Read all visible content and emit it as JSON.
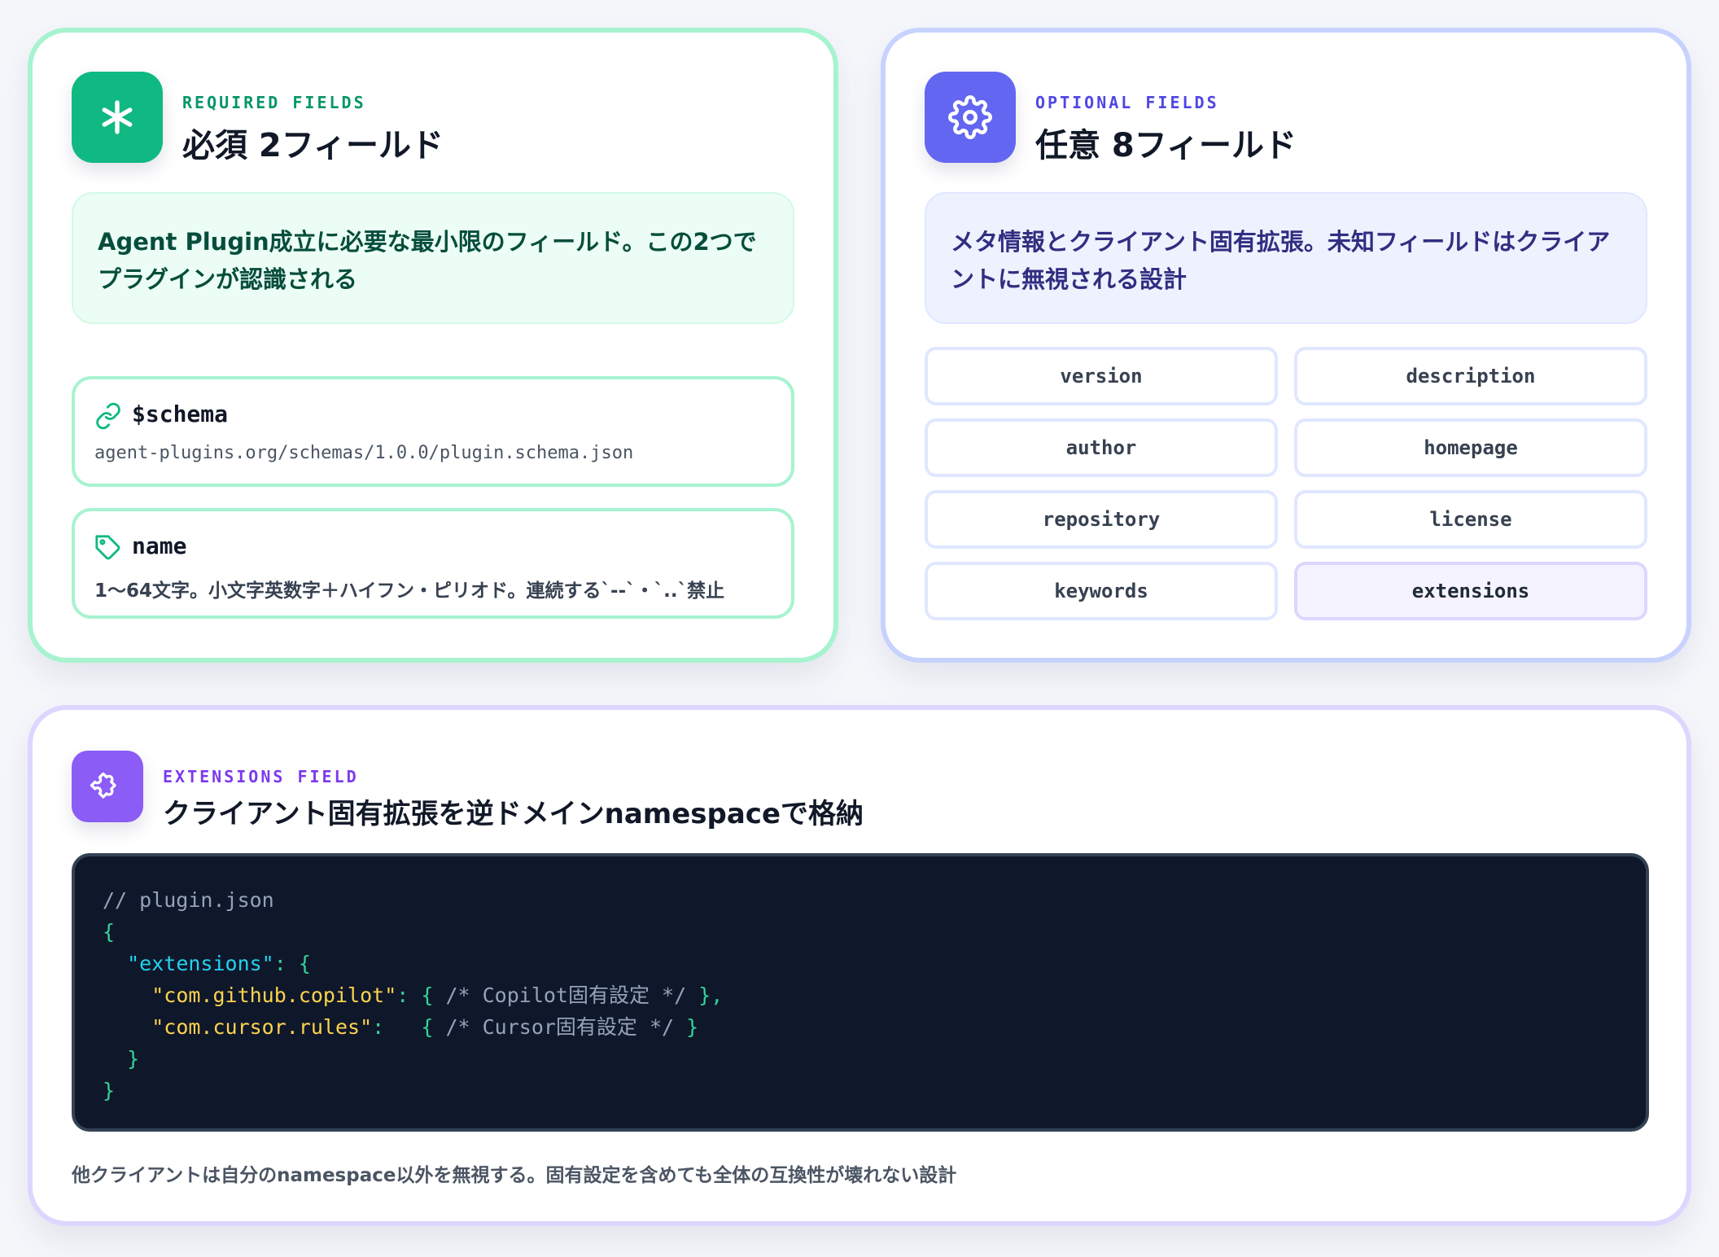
{
  "required": {
    "eyebrow": "REQUIRED FIELDS",
    "title": "必須 2フィールド",
    "description": "Agent Plugin成立に必要な最小限のフィールド。この2つでプラグインが認識される",
    "icon": "asterisk-icon",
    "accent": "#10b981",
    "fields": [
      {
        "label": "$schema",
        "detail": "agent-plugins.org/schemas/1.0.0/plugin.schema.json",
        "icon": "link-icon"
      },
      {
        "label": "name",
        "detail": "1〜64文字。小文字英数字＋ハイフン・ピリオド。連続する`--`・`..`禁止",
        "icon": "tag-icon"
      }
    ]
  },
  "optional": {
    "eyebrow": "OPTIONAL FIELDS",
    "title": "任意 8フィールド",
    "description": "メタ情報とクライアント固有拡張。未知フィールドはクライアントに無視される設計",
    "icon": "gear-icon",
    "accent": "#6366f1",
    "fields": [
      "version",
      "description",
      "author",
      "homepage",
      "repository",
      "license",
      "keywords",
      "extensions"
    ]
  },
  "extensions": {
    "eyebrow": "EXTENSIONS FIELD",
    "title": "クライアント固有拡張を逆ドメインnamespaceで格納",
    "icon": "puzzle-icon",
    "accent": "#8b5cf6",
    "code": {
      "comment": "// plugin.json",
      "open_brace": "{",
      "ext_key": "\"extensions\"",
      "ext_colon": ": {",
      "copilot_key": "\"com.github.copilot\"",
      "copilot_colon": ": { ",
      "copilot_comment": "/* Copilot固有設定 */",
      "copilot_close": " },",
      "cursor_key": "\"com.cursor.rules\"",
      "cursor_colon": ":   { ",
      "cursor_comment": "/* Cursor固有設定 */",
      "cursor_close": " }",
      "inner_close": "}",
      "outer_close": "}"
    },
    "note": "他クライアントは自分のnamespace以外を無視する。固有設定を含めても全体の互換性が壊れない設計"
  }
}
